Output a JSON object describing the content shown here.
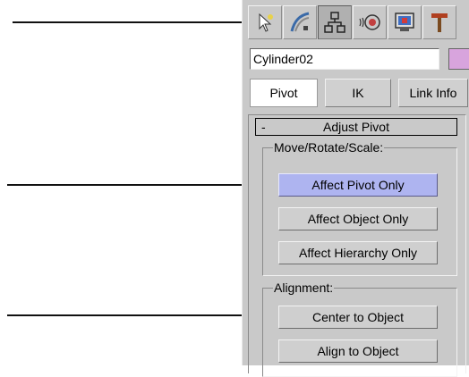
{
  "callout_lines": [
    "callout-1",
    "callout-2",
    "callout-3"
  ],
  "command_panel": {
    "tabs": [
      {
        "name": "create-icon",
        "active": false
      },
      {
        "name": "modify-icon",
        "active": false
      },
      {
        "name": "hierarchy-icon",
        "active": true
      },
      {
        "name": "motion-icon",
        "active": false
      },
      {
        "name": "display-icon",
        "active": false
      },
      {
        "name": "utilities-icon",
        "active": false
      }
    ],
    "object_name": "Cylinder02",
    "object_color": "#d8a4dd",
    "subtabs": [
      "Pivot",
      "IK",
      "Link Info"
    ],
    "active_subtab": "Pivot",
    "rollout": {
      "collapse_symbol": "-",
      "title": "Adjust Pivot",
      "move_group": {
        "label": "Move/Rotate/Scale:",
        "buttons": [
          "Affect Pivot Only",
          "Affect Object Only",
          "Affect Hierarchy Only"
        ],
        "active_button": "Affect Pivot Only"
      },
      "alignment_group": {
        "label": "Alignment:",
        "buttons": [
          "Center to Object",
          "Align to Object"
        ]
      }
    }
  },
  "colors": {
    "panel": "#c9c9c9",
    "active_button": "#aeb4f0",
    "active_subtab": "#ffffff"
  }
}
